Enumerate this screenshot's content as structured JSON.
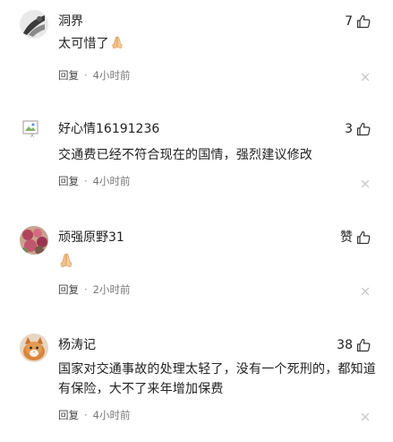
{
  "comments": [
    {
      "username": "洞界",
      "likes": "7",
      "text": "太可惜了",
      "emoji": "folded-hands",
      "reply_label": "回复",
      "separator": "·",
      "time": "4小时前"
    },
    {
      "username": "好心情16191236",
      "likes": "3",
      "text": "交通费已经不符合现在的国情，强烈建议修改",
      "reply_label": "回复",
      "separator": "·",
      "time": "4小时前"
    },
    {
      "username": "顽强原野31",
      "likes": "赞",
      "text": "",
      "emoji": "folded-hands",
      "reply_label": "回复",
      "separator": "·",
      "time": "2小时前"
    },
    {
      "username": "杨涛记",
      "likes": "38",
      "text": "国家对交通事故的处理太轻了，没有一个死刑的，都知道有保险，大不了来年增加保费",
      "reply_label": "回复",
      "separator": "·",
      "time": "4小时前"
    }
  ],
  "colors": {
    "text": "#222222",
    "meta": "#777777",
    "close": "#c8c8c8",
    "emoji": "#f2c08a"
  }
}
